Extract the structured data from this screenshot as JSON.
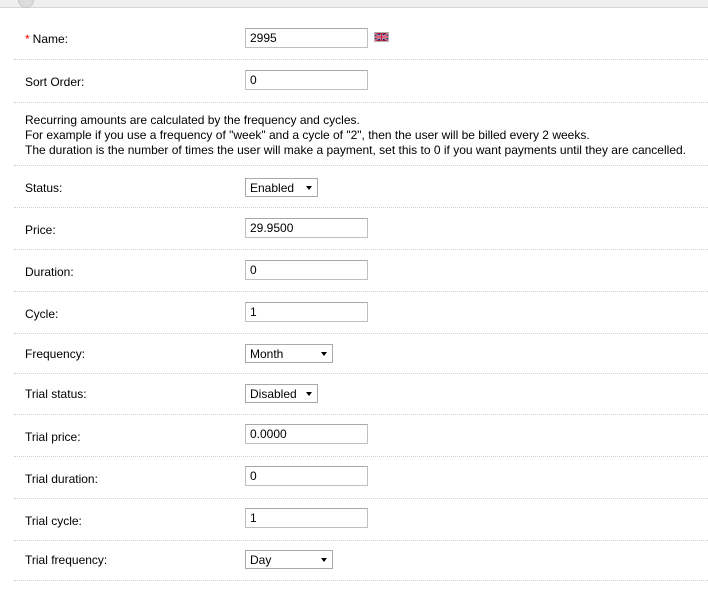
{
  "form": {
    "name": {
      "label": "Name:",
      "required_mark": "*",
      "value": "2995",
      "flag_icon": "uk-flag-icon"
    },
    "sort_order": {
      "label": "Sort Order:",
      "value": "0"
    },
    "info_lines": [
      "Recurring amounts are calculated by the frequency and cycles.",
      "For example if you use a frequency of \"week\" and a cycle of \"2\", then the user will be billed every 2 weeks.",
      "The duration is the number of times the user will make a payment, set this to 0 if you want payments until they are cancelled."
    ],
    "status": {
      "label": "Status:",
      "value": "Enabled"
    },
    "price": {
      "label": "Price:",
      "value": "29.9500"
    },
    "duration": {
      "label": "Duration:",
      "value": "0"
    },
    "cycle": {
      "label": "Cycle:",
      "value": "1"
    },
    "frequency": {
      "label": "Frequency:",
      "value": "Month"
    },
    "trial_status": {
      "label": "Trial status:",
      "value": "Disabled"
    },
    "trial_price": {
      "label": "Trial price:",
      "value": "0.0000"
    },
    "trial_duration": {
      "label": "Trial duration:",
      "value": "0"
    },
    "trial_cycle": {
      "label": "Trial cycle:",
      "value": "1"
    },
    "trial_frequency": {
      "label": "Trial frequency:",
      "value": "Day"
    }
  }
}
